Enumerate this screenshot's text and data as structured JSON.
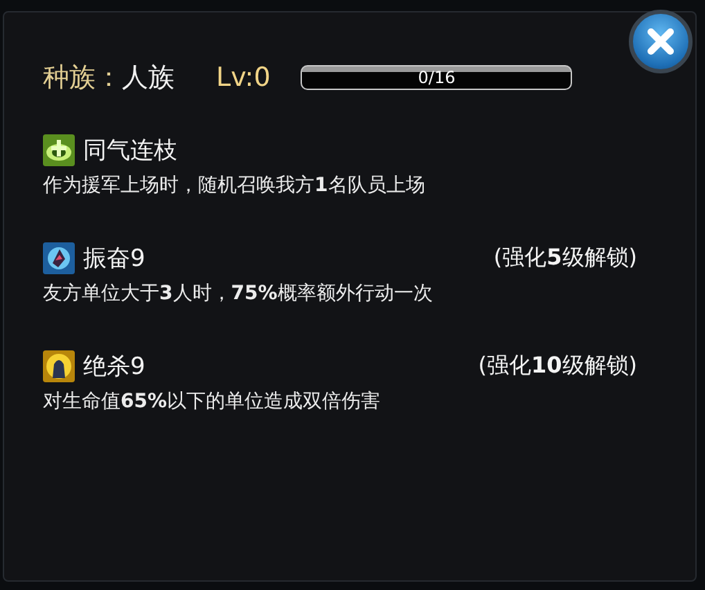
{
  "header": {
    "race_label": "种族：",
    "race": "人族",
    "level_label": "Lv:0",
    "progress": {
      "text": "0/16",
      "level": 0
    }
  },
  "skills": [
    {
      "kind": "heal",
      "name": "同气连枝",
      "description": "作为援军上场时，随机召唤我方**1**名队员上场"
    },
    {
      "kind": "rally",
      "name": "振奋9",
      "unlock": "(强化**5**级解锁)",
      "description": "友方单位大于**3**人时，**75%**概率额外行动一次"
    },
    {
      "kind": "strike",
      "name": "绝杀9",
      "unlock": "(强化**10**级解锁)",
      "description": "对生命值**65%**以下的单位造成双倍伤害"
    }
  ]
}
